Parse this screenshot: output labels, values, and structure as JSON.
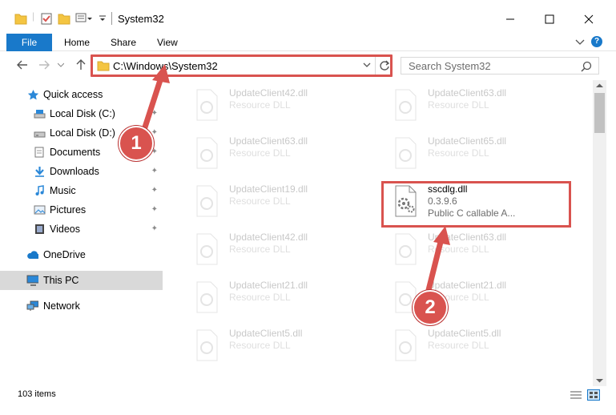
{
  "window": {
    "title": "System32",
    "minimize_icon": "minimize-icon",
    "maximize_icon": "maximize-icon",
    "close_icon": "close-icon"
  },
  "ribbon": {
    "tabs": [
      "File",
      "Home",
      "Share",
      "View"
    ]
  },
  "address": {
    "path": "C:\\Windows\\System32",
    "search_placeholder": "Search System32"
  },
  "nav": {
    "quick_access": "Quick access",
    "items": [
      {
        "label": "Local Disk (C:)",
        "icon": "drive-icon",
        "pinned": true
      },
      {
        "label": "Local Disk (D:)",
        "icon": "drive-icon",
        "pinned": true
      },
      {
        "label": "Documents",
        "icon": "documents-icon",
        "pinned": true
      },
      {
        "label": "Downloads",
        "icon": "downloads-icon",
        "pinned": true
      },
      {
        "label": "Music",
        "icon": "music-icon",
        "pinned": true
      },
      {
        "label": "Pictures",
        "icon": "pictures-icon",
        "pinned": true
      },
      {
        "label": "Videos",
        "icon": "videos-icon",
        "pinned": true
      }
    ],
    "onedrive": "OneDrive",
    "this_pc": "This PC",
    "network": "Network"
  },
  "files": {
    "left": [
      {
        "name": "UpdateClient42.dll",
        "type": "Resource DLL"
      },
      {
        "name": "UpdateClient63.dll",
        "type": "Resource DLL"
      },
      {
        "name": "UpdateClient19.dll",
        "type": "Resource DLL"
      },
      {
        "name": "UpdateClient42.dll",
        "type": "Resource DLL"
      },
      {
        "name": "UpdateClient21.dll",
        "type": "Resource DLL"
      },
      {
        "name": "UpdateClient5.dll",
        "type": "Resource DLL"
      }
    ],
    "right": [
      {
        "name": "UpdateClient63.dll",
        "type": "Resource DLL"
      },
      {
        "name": "UpdateClient65.dll",
        "type": "Resource DLL"
      },
      {
        "name": "UpdateClient63.dll",
        "type": "Resource DLL"
      },
      {
        "name": "UpdateClient21.dll",
        "type": "Resource DLL"
      },
      {
        "name": "UpdateClient5.dll",
        "type": "Resource DLL"
      }
    ],
    "highlighted": {
      "name": "sscdlg.dll",
      "version": "0.3.9.6",
      "description": "Public C callable A..."
    }
  },
  "status": {
    "count": "103 items"
  },
  "annotations": {
    "step1": "1",
    "step2": "2",
    "color": "#d9534f"
  }
}
